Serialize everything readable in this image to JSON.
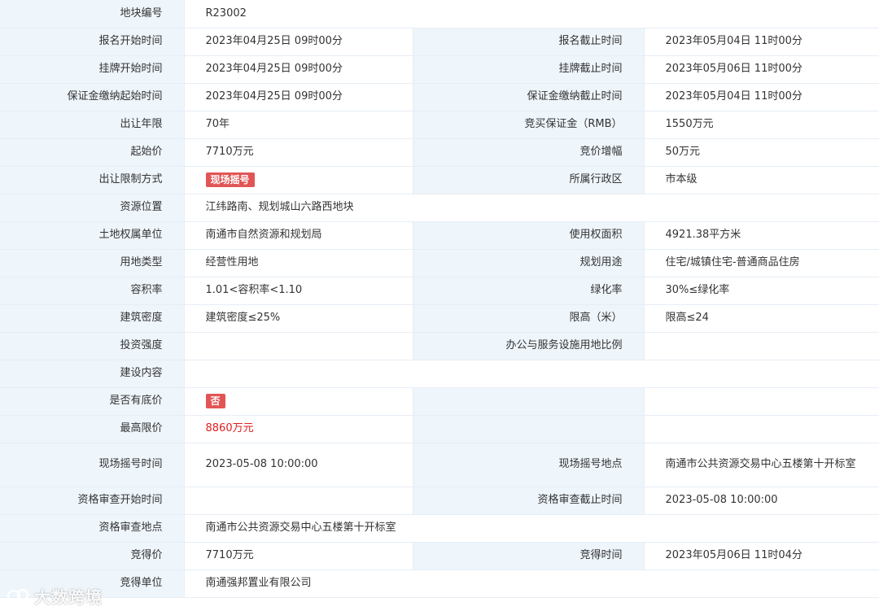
{
  "rows": [
    {
      "l1": "地块编号",
      "v1": "R23002"
    },
    {
      "l1": "报名开始时间",
      "v1": "2023年04月25日 09时00分",
      "l2": "报名截止时间",
      "v2": "2023年05月04日 11时00分"
    },
    {
      "l1": "挂牌开始时间",
      "v1": "2023年04月25日 09时00分",
      "l2": "挂牌截止时间",
      "v2": "2023年05月06日 11时00分"
    },
    {
      "l1": "保证金缴纳起始时间",
      "v1": "2023年04月25日 09时00分",
      "l2": "保证金缴纳截止时间",
      "v2": "2023年05月04日 11时00分"
    },
    {
      "l1": "出让年限",
      "v1": "70年",
      "l2": "竞买保证金（RMB）",
      "v2": "1550万元"
    },
    {
      "l1": "起始价",
      "v1": "7710万元",
      "l2": "竞价增幅",
      "v2": "50万元"
    },
    {
      "l1": "出让限制方式",
      "v1": "现场摇号",
      "l2": "所属行政区",
      "v2": "市本级"
    },
    {
      "l1": "资源位置",
      "v1": "江纬路南、规划城山六路西地块"
    },
    {
      "l1": "土地权属单位",
      "v1": "南通市自然资源和规划局",
      "l2": "使用权面积",
      "v2": "4921.38平方米"
    },
    {
      "l1": "用地类型",
      "v1": "经营性用地",
      "l2": "规划用途",
      "v2": "住宅/城镇住宅-普通商品住房"
    },
    {
      "l1": "容积率",
      "v1": "1.01<容积率<1.10",
      "l2": "绿化率",
      "v2": "30%≤绿化率"
    },
    {
      "l1": "建筑密度",
      "v1": "建筑密度≤25%",
      "l2": "限高（米）",
      "v2": "限高≤24"
    },
    {
      "l1": "投资强度",
      "v1": "",
      "l2": "办公与服务设施用地比例",
      "v2": ""
    },
    {
      "l1": "建设内容",
      "v1": ""
    },
    {
      "l1": "是否有底价",
      "v1": "否",
      "l2": "",
      "v2": ""
    },
    {
      "l1": "最高限价",
      "v1": "8860万元",
      "l2": "",
      "v2": ""
    },
    {
      "l1": "现场摇号时间",
      "v1": "2023-05-08 10:00:00",
      "l2": "现场摇号地点",
      "v2": "南通市公共资源交易中心五楼第十开标室"
    },
    {
      "l1": "资格审查开始时间",
      "v1": "",
      "l2": "资格审查截止时间",
      "v2": "2023-05-08 10:00:00"
    },
    {
      "l1": "资格审查地点",
      "v1": "南通市公共资源交易中心五楼第十开标室"
    },
    {
      "l1": "竞得价",
      "v1": "7710万元",
      "l2": "竞得时间",
      "v2": "2023年05月06日 11时04分"
    },
    {
      "l1": "竞得单位",
      "v1": "南通强邦置业有限公司"
    }
  ],
  "watermark": {
    "text": "大数跨境"
  },
  "colors": {
    "label_bg": "#eef5fb",
    "border": "#e6eef5",
    "highlight_red": "#e02020",
    "tag_bg": "#e25555"
  }
}
